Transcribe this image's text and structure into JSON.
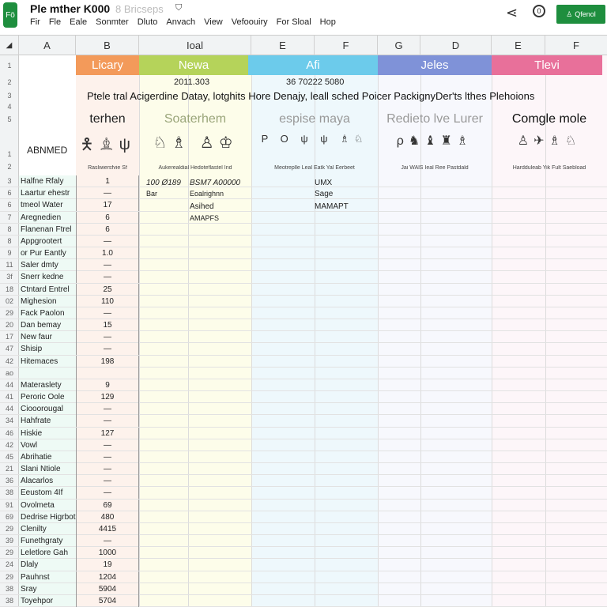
{
  "app": {
    "title": "Ple mther K000",
    "subtitle": "8 Bricseps",
    "menu": [
      "Fir",
      "Fle",
      "Eale",
      "Sonmter",
      "Dluto",
      "Anvach",
      "View",
      "Vefoouiry",
      "For Sloal",
      "Hop"
    ],
    "account_label": "Qfenol"
  },
  "columns": [
    "A",
    "B",
    "Ioal",
    "E",
    "F",
    "G",
    "D",
    "E",
    "F"
  ],
  "header_bars": [
    "Licary",
    "Newa",
    "Afi",
    "Jeles",
    "Tlevi"
  ],
  "row2": {
    "left": "2011.303",
    "right": "36 70222 5080"
  },
  "banner": "Ptele tral Acigerdine Datay, lotghits Hore Denajy, leall sched Poicer PackignyDer'ts lthes Plehoions",
  "sections": [
    "terhen",
    "Soaterhem",
    "espise maya",
    "Redieto lve Lurer",
    "Comgle mole"
  ],
  "a_header": "ABNMED",
  "icon_captions": [
    "Raslwiersfvie  Sf",
    "Aukerealdial   Hedoteflastel  Ind",
    "Meotreplle Leal   Eatk  Yal  Eerbeet",
    "Jai  WAlS  Ieal  Ree Pastdald",
    "Hardduleab  Yik  Fult Saebload"
  ],
  "rows": [
    {
      "n": "3",
      "a": "Halfne Rfaly",
      "b": "1"
    },
    {
      "n": "6",
      "a": "Laartur ehestr",
      "b": "—"
    },
    {
      "n": "6",
      "a": "tmeol Water",
      "b": "17"
    },
    {
      "n": "7",
      "a": "Aregnedien",
      "b": "6"
    },
    {
      "n": "8",
      "a": "Flanenan Ftrel",
      "b": "6"
    },
    {
      "n": "8",
      "a": "Appgrootert",
      "b": "—"
    },
    {
      "n": "9",
      "a": "or Pur Eantly",
      "b": "1.0"
    },
    {
      "n": "11",
      "a": "Saler dmty",
      "b": "—"
    },
    {
      "n": "3f",
      "a": "Snerr kedne",
      "b": "—"
    },
    {
      "n": "18",
      "a": "Ctntard Entrel",
      "b": "25"
    },
    {
      "n": "02",
      "a": "Mighesion",
      "b": "110"
    },
    {
      "n": "29",
      "a": "Fack Paolon",
      "b": "—"
    },
    {
      "n": "20",
      "a": "Dan bemay",
      "b": "15"
    },
    {
      "n": "17",
      "a": "New faur",
      "b": "—"
    },
    {
      "n": "47",
      "a": "Shisip",
      "b": "—"
    },
    {
      "n": "42",
      "a": "Hitemaces",
      "b": "198"
    },
    {
      "n": "ao",
      "a": "",
      "b": ""
    },
    {
      "n": "44",
      "a": "Materaslety",
      "b": "9"
    },
    {
      "n": "41",
      "a": "Peroric Oole",
      "b": "129"
    },
    {
      "n": "44",
      "a": "Ciooorougal",
      "b": "—"
    },
    {
      "n": "34",
      "a": "Hahfrate",
      "b": "—"
    },
    {
      "n": "46",
      "a": "Hiskie",
      "b": "127"
    },
    {
      "n": "42",
      "a": "Vowl",
      "b": "—"
    },
    {
      "n": "45",
      "a": "Abrihatie",
      "b": "—"
    },
    {
      "n": "21",
      "a": "Slani Ntiole",
      "b": "—"
    },
    {
      "n": "36",
      "a": "Alacarlos",
      "b": "—"
    },
    {
      "n": "38",
      "a": "Eeustom 4If",
      "b": "—"
    },
    {
      "n": "91",
      "a": "Ovolmeta",
      "b": "69"
    },
    {
      "n": "69",
      "a": "Dedrise Higrbot",
      "b": "480"
    },
    {
      "n": "29",
      "a": "Clenilty",
      "b": "4415"
    },
    {
      "n": "39",
      "a": "Funethgraty",
      "b": "—"
    },
    {
      "n": "29",
      "a": "Leletlore Gah",
      "b": "1000"
    },
    {
      "n": "24",
      "a": "Dlaly",
      "b": "19"
    },
    {
      "n": "29",
      "a": "Pauhnst",
      "b": "1204"
    },
    {
      "n": "38",
      "a": "Sray",
      "b": "5904"
    },
    {
      "n": "38",
      "a": "Toyehpor",
      "b": "5704"
    }
  ],
  "cells": {
    "r3c": "100 Ø189",
    "r3d": "BSM7 A00000",
    "r3f": "UMX",
    "r4c": "Bar",
    "r4d": "Eoalrighnn",
    "r4f": "Sage",
    "r5d": "Asihed",
    "r5f": "MAMAPT",
    "r6d": "AMAPFS"
  },
  "colors": {
    "green": "#1e8e3e",
    "bars": [
      "#f39a5a",
      "#b5d35a",
      "#6ccbeb",
      "#7f92d8",
      "#e8709a"
    ]
  }
}
